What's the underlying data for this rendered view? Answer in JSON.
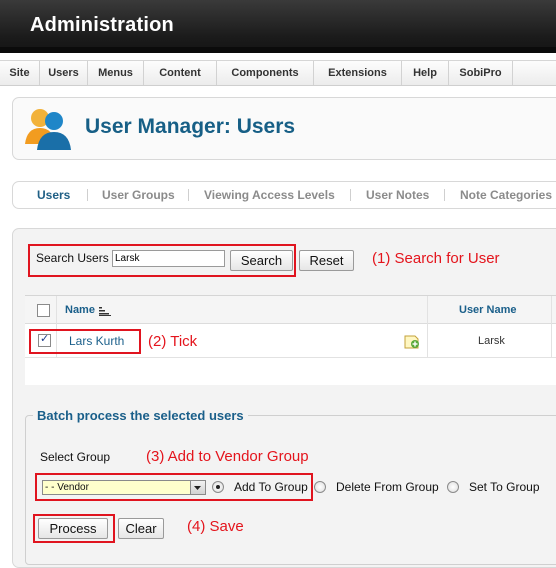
{
  "header": {
    "title": "Administration"
  },
  "menu": [
    "Site",
    "Users",
    "Menus",
    "Content",
    "Components",
    "Extensions",
    "Help",
    "SobiPro"
  ],
  "page": {
    "title": "User Manager: Users"
  },
  "subtabs": [
    "Users",
    "User Groups",
    "Viewing Access Levels",
    "User Notes",
    "Note Categories"
  ],
  "search": {
    "label": "Search Users",
    "value": "Larsk",
    "search_button": "Search",
    "reset_button": "Reset"
  },
  "table": {
    "headers": {
      "name": "Name",
      "username": "User Name"
    },
    "rows": [
      {
        "name": "Lars Kurth",
        "username": "Larsk",
        "checked": true
      }
    ]
  },
  "batch": {
    "legend": "Batch process the selected users",
    "select_label": "Select Group",
    "selected_group": "- - Vendor",
    "options": [
      "Add To Group",
      "Delete From Group",
      "Set To Group"
    ],
    "selected_option": "Add To Group",
    "process_button": "Process",
    "clear_button": "Clear"
  },
  "annotations": {
    "step1": "(1) Search for User",
    "step2": "(2) Tick",
    "step3": "(3) Add to Vendor Group",
    "step4": "(4) Save"
  },
  "colors": {
    "accent": "#175f86",
    "annotation": "#e4141c",
    "select_bg": "#ffffcc"
  }
}
